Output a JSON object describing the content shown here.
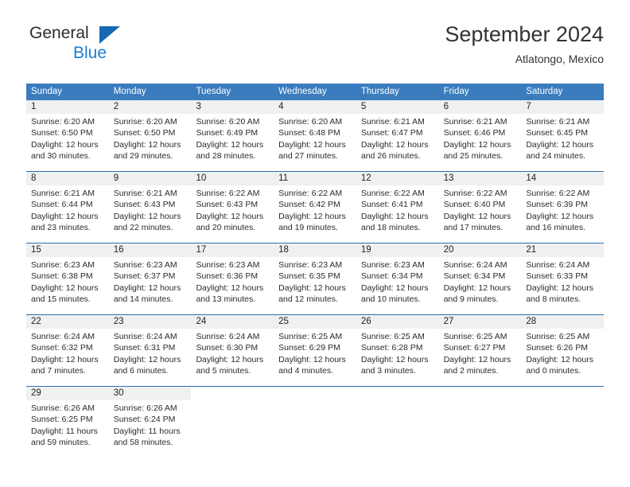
{
  "brand": {
    "name_dark": "General",
    "name_blue": "Blue",
    "accent_blue": "#1b7fd4",
    "triangle_blue": "#1668b3"
  },
  "header": {
    "title": "September 2024",
    "subtitle": "Atlatongo, Mexico"
  },
  "calendar": {
    "header_bg": "#3a7cbe",
    "header_text_color": "#ffffff",
    "day_number_bg": "#f0f0f0",
    "row_divider_color": "#2f6fae",
    "weekdays": [
      "Sunday",
      "Monday",
      "Tuesday",
      "Wednesday",
      "Thursday",
      "Friday",
      "Saturday"
    ],
    "weeks": [
      [
        {
          "day": "1",
          "sunrise": "Sunrise: 6:20 AM",
          "sunset": "Sunset: 6:50 PM",
          "daylight": "Daylight: 12 hours and 30 minutes."
        },
        {
          "day": "2",
          "sunrise": "Sunrise: 6:20 AM",
          "sunset": "Sunset: 6:50 PM",
          "daylight": "Daylight: 12 hours and 29 minutes."
        },
        {
          "day": "3",
          "sunrise": "Sunrise: 6:20 AM",
          "sunset": "Sunset: 6:49 PM",
          "daylight": "Daylight: 12 hours and 28 minutes."
        },
        {
          "day": "4",
          "sunrise": "Sunrise: 6:20 AM",
          "sunset": "Sunset: 6:48 PM",
          "daylight": "Daylight: 12 hours and 27 minutes."
        },
        {
          "day": "5",
          "sunrise": "Sunrise: 6:21 AM",
          "sunset": "Sunset: 6:47 PM",
          "daylight": "Daylight: 12 hours and 26 minutes."
        },
        {
          "day": "6",
          "sunrise": "Sunrise: 6:21 AM",
          "sunset": "Sunset: 6:46 PM",
          "daylight": "Daylight: 12 hours and 25 minutes."
        },
        {
          "day": "7",
          "sunrise": "Sunrise: 6:21 AM",
          "sunset": "Sunset: 6:45 PM",
          "daylight": "Daylight: 12 hours and 24 minutes."
        }
      ],
      [
        {
          "day": "8",
          "sunrise": "Sunrise: 6:21 AM",
          "sunset": "Sunset: 6:44 PM",
          "daylight": "Daylight: 12 hours and 23 minutes."
        },
        {
          "day": "9",
          "sunrise": "Sunrise: 6:21 AM",
          "sunset": "Sunset: 6:43 PM",
          "daylight": "Daylight: 12 hours and 22 minutes."
        },
        {
          "day": "10",
          "sunrise": "Sunrise: 6:22 AM",
          "sunset": "Sunset: 6:43 PM",
          "daylight": "Daylight: 12 hours and 20 minutes."
        },
        {
          "day": "11",
          "sunrise": "Sunrise: 6:22 AM",
          "sunset": "Sunset: 6:42 PM",
          "daylight": "Daylight: 12 hours and 19 minutes."
        },
        {
          "day": "12",
          "sunrise": "Sunrise: 6:22 AM",
          "sunset": "Sunset: 6:41 PM",
          "daylight": "Daylight: 12 hours and 18 minutes."
        },
        {
          "day": "13",
          "sunrise": "Sunrise: 6:22 AM",
          "sunset": "Sunset: 6:40 PM",
          "daylight": "Daylight: 12 hours and 17 minutes."
        },
        {
          "day": "14",
          "sunrise": "Sunrise: 6:22 AM",
          "sunset": "Sunset: 6:39 PM",
          "daylight": "Daylight: 12 hours and 16 minutes."
        }
      ],
      [
        {
          "day": "15",
          "sunrise": "Sunrise: 6:23 AM",
          "sunset": "Sunset: 6:38 PM",
          "daylight": "Daylight: 12 hours and 15 minutes."
        },
        {
          "day": "16",
          "sunrise": "Sunrise: 6:23 AM",
          "sunset": "Sunset: 6:37 PM",
          "daylight": "Daylight: 12 hours and 14 minutes."
        },
        {
          "day": "17",
          "sunrise": "Sunrise: 6:23 AM",
          "sunset": "Sunset: 6:36 PM",
          "daylight": "Daylight: 12 hours and 13 minutes."
        },
        {
          "day": "18",
          "sunrise": "Sunrise: 6:23 AM",
          "sunset": "Sunset: 6:35 PM",
          "daylight": "Daylight: 12 hours and 12 minutes."
        },
        {
          "day": "19",
          "sunrise": "Sunrise: 6:23 AM",
          "sunset": "Sunset: 6:34 PM",
          "daylight": "Daylight: 12 hours and 10 minutes."
        },
        {
          "day": "20",
          "sunrise": "Sunrise: 6:24 AM",
          "sunset": "Sunset: 6:34 PM",
          "daylight": "Daylight: 12 hours and 9 minutes."
        },
        {
          "day": "21",
          "sunrise": "Sunrise: 6:24 AM",
          "sunset": "Sunset: 6:33 PM",
          "daylight": "Daylight: 12 hours and 8 minutes."
        }
      ],
      [
        {
          "day": "22",
          "sunrise": "Sunrise: 6:24 AM",
          "sunset": "Sunset: 6:32 PM",
          "daylight": "Daylight: 12 hours and 7 minutes."
        },
        {
          "day": "23",
          "sunrise": "Sunrise: 6:24 AM",
          "sunset": "Sunset: 6:31 PM",
          "daylight": "Daylight: 12 hours and 6 minutes."
        },
        {
          "day": "24",
          "sunrise": "Sunrise: 6:24 AM",
          "sunset": "Sunset: 6:30 PM",
          "daylight": "Daylight: 12 hours and 5 minutes."
        },
        {
          "day": "25",
          "sunrise": "Sunrise: 6:25 AM",
          "sunset": "Sunset: 6:29 PM",
          "daylight": "Daylight: 12 hours and 4 minutes."
        },
        {
          "day": "26",
          "sunrise": "Sunrise: 6:25 AM",
          "sunset": "Sunset: 6:28 PM",
          "daylight": "Daylight: 12 hours and 3 minutes."
        },
        {
          "day": "27",
          "sunrise": "Sunrise: 6:25 AM",
          "sunset": "Sunset: 6:27 PM",
          "daylight": "Daylight: 12 hours and 2 minutes."
        },
        {
          "day": "28",
          "sunrise": "Sunrise: 6:25 AM",
          "sunset": "Sunset: 6:26 PM",
          "daylight": "Daylight: 12 hours and 0 minutes."
        }
      ],
      [
        {
          "day": "29",
          "sunrise": "Sunrise: 6:26 AM",
          "sunset": "Sunset: 6:25 PM",
          "daylight": "Daylight: 11 hours and 59 minutes."
        },
        {
          "day": "30",
          "sunrise": "Sunrise: 6:26 AM",
          "sunset": "Sunset: 6:24 PM",
          "daylight": "Daylight: 11 hours and 58 minutes."
        },
        {
          "day": "",
          "sunrise": "",
          "sunset": "",
          "daylight": ""
        },
        {
          "day": "",
          "sunrise": "",
          "sunset": "",
          "daylight": ""
        },
        {
          "day": "",
          "sunrise": "",
          "sunset": "",
          "daylight": ""
        },
        {
          "day": "",
          "sunrise": "",
          "sunset": "",
          "daylight": ""
        },
        {
          "day": "",
          "sunrise": "",
          "sunset": "",
          "daylight": ""
        }
      ]
    ]
  }
}
